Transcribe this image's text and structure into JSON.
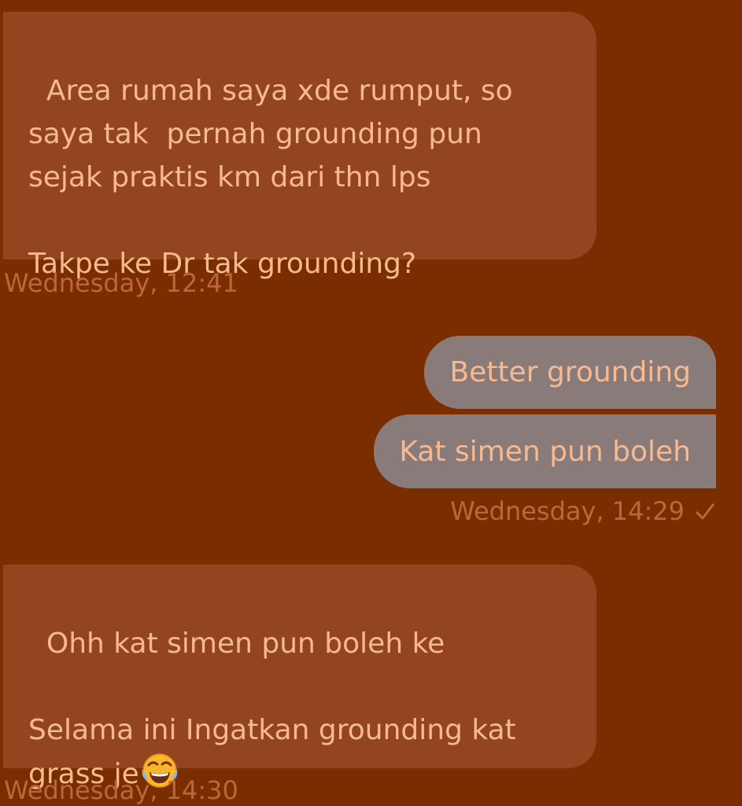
{
  "messages": [
    {
      "direction": "received",
      "text": "Area rumah saya xde rumput, so\nsaya tak  pernah grounding pun\nsejak praktis km dari thn lps\n\nTakpe ke Dr tak grounding?"
    },
    {
      "direction": "sent",
      "text": "Better grounding"
    },
    {
      "direction": "sent",
      "text": "Kat simen pun boleh"
    },
    {
      "direction": "received",
      "text": "Ohh kat simen pun boleh ke\n\nSelama ini Ingatkan grounding kat\ngrass je",
      "emoji": "tears-of-joy-emoji"
    }
  ],
  "timestamps": {
    "first": "Wednesday, 12:41",
    "second": "Wednesday, 14:29",
    "third": "Wednesday, 14:30"
  },
  "status_icon": "checkmark-icon",
  "colors": {
    "background": "#7a2e00",
    "received_bubble": "#934520",
    "sent_bubble": "#8a7b7b",
    "message_text": "#f7b98f",
    "timestamp_text": "#b7693c"
  }
}
